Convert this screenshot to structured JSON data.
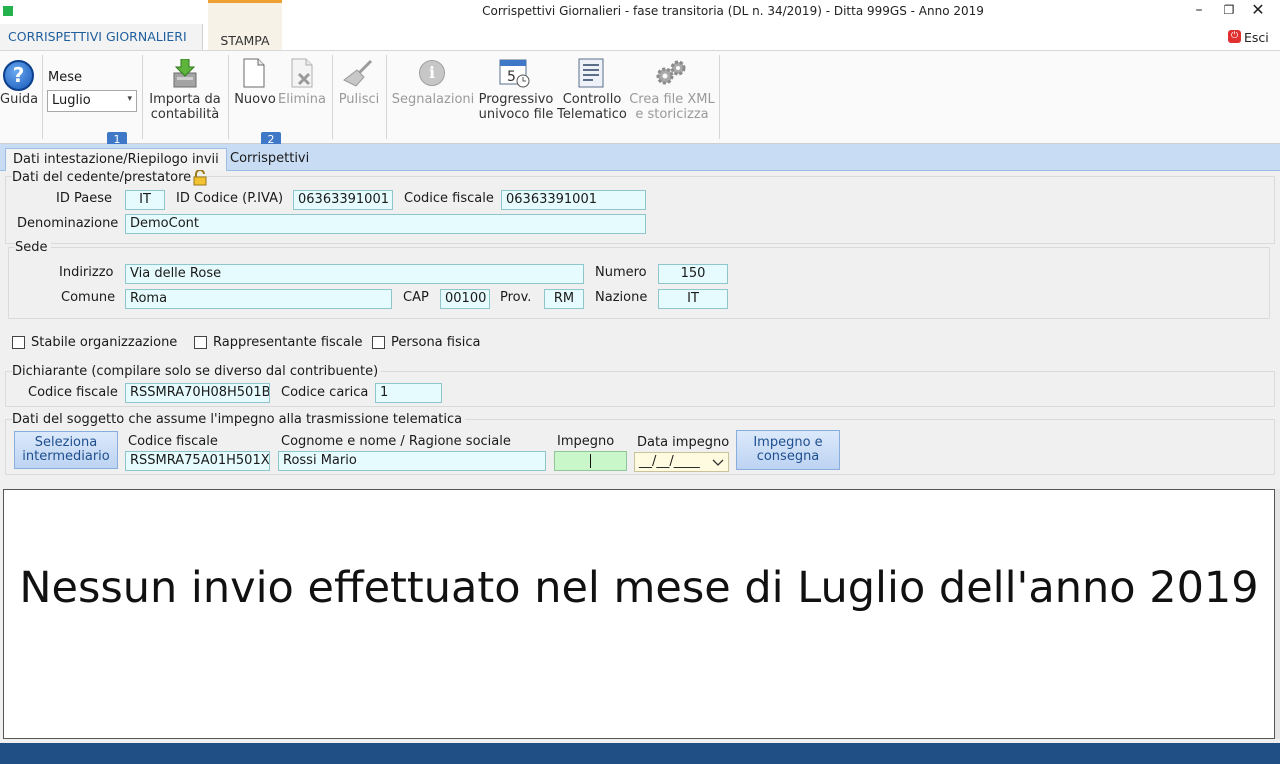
{
  "window": {
    "title": "Corrispettivi Giornalieri - fase transitoria (DL n. 34/2019) - Ditta 999GS - Anno 2019",
    "minimize_icon": "minimize-icon",
    "restore_icon": "restore-icon",
    "close_icon": "close-icon"
  },
  "ribbon_tabs": {
    "main": "CORRISPETTIVI GIORNALIERI",
    "stampa": "STAMPA",
    "esci": "Esci"
  },
  "ribbon": {
    "guida": "Guida",
    "mese_label": "Mese",
    "mese_value": "Luglio",
    "importa_line1": "Importa da",
    "importa_line2": "contabilità",
    "nuovo": "Nuovo",
    "elimina": "Elimina",
    "pulisci": "Pulisci",
    "segnalazioni": "Segnalazioni",
    "progressivo_line1": "Progressivo",
    "progressivo_line2": "univoco file",
    "controllo_line1": "Controllo",
    "controllo_line2": "Telematico",
    "crea_line1": "Crea file XML",
    "crea_line2": "e storicizza",
    "badge1": "1",
    "badge2": "2"
  },
  "content_tabs": {
    "dati": "Dati intestazione/Riepilogo invii",
    "corrispettivi": "Corrispettivi"
  },
  "cedente": {
    "section_title": "Dati del cedente/prestatore",
    "id_paese_label": "ID Paese",
    "id_paese": "IT",
    "id_codice_label": "ID Codice (P.IVA)",
    "id_codice": "06363391001",
    "codice_fiscale_label": "Codice fiscale",
    "codice_fiscale": "06363391001",
    "denominazione_label": "Denominazione",
    "denominazione": "DemoCont"
  },
  "sede": {
    "section_title": "Sede",
    "indirizzo_label": "Indirizzo",
    "indirizzo": "Via delle Rose",
    "numero_label": "Numero",
    "numero": "150",
    "comune_label": "Comune",
    "comune": "Roma",
    "cap_label": "CAP",
    "cap": "00100",
    "prov_label": "Prov.",
    "prov": "RM",
    "nazione_label": "Nazione",
    "nazione": "IT"
  },
  "checkboxes": {
    "stabile": "Stabile organizzazione",
    "rappresentante": "Rappresentante fiscale",
    "persona": "Persona fisica"
  },
  "dichiarante": {
    "section_title": "Dichiarante (compilare solo se diverso dal contribuente)",
    "codice_fiscale_label": "Codice fiscale",
    "codice_fiscale": "RSSMRA70H08H501B",
    "codice_carica_label": "Codice carica",
    "codice_carica": "1"
  },
  "impegno": {
    "section_title": "Dati del soggetto che assume l'impegno alla trasmissione telematica",
    "seleziona_line1": "Seleziona",
    "seleziona_line2": "intermediario",
    "codice_fiscale_label": "Codice fiscale",
    "codice_fiscale": "RSSMRA75A01H501X",
    "cognome_label": "Cognome e nome / Ragione sociale",
    "cognome": "Rossi Mario",
    "impegno_label": "Impegno",
    "impegno": "",
    "data_label": "Data impegno",
    "data": "__/__/____",
    "consegna_line1": "Impegno e",
    "consegna_line2": "consegna"
  },
  "message": "Nessun invio effettuato nel mese di Luglio dell'anno 2019",
  "colors": {
    "accent": "#3f78c6",
    "field_bg": "#e6fbfd",
    "status_bar": "#1f4f85"
  }
}
